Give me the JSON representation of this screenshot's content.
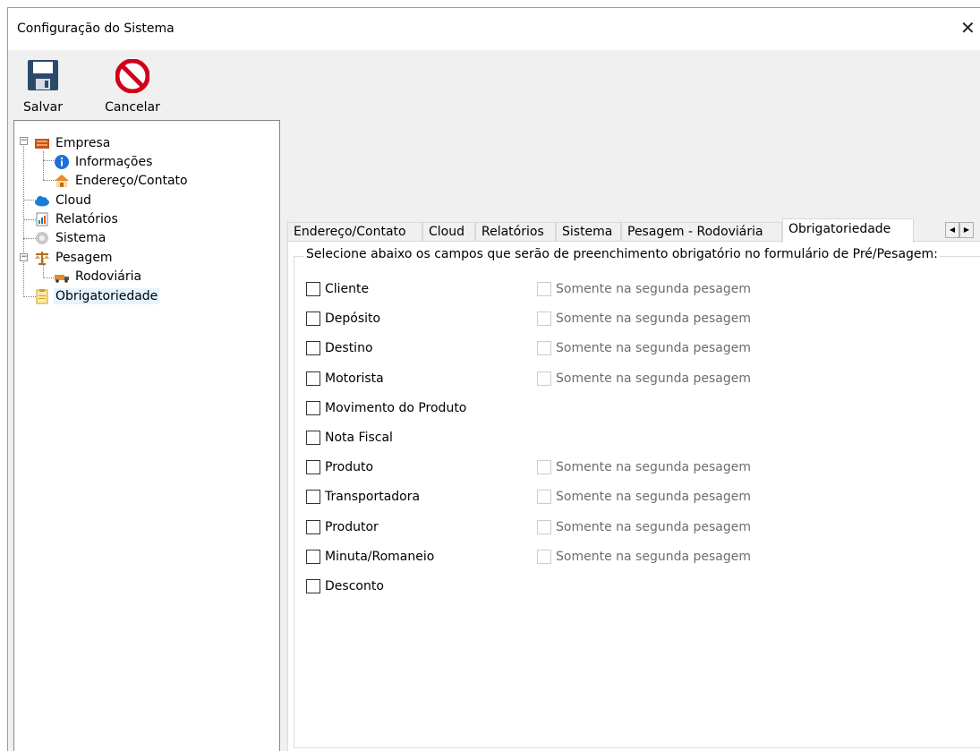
{
  "window": {
    "title": "Configuração do Sistema",
    "close_glyph": "✕"
  },
  "toolbar": {
    "save_label": "Salvar",
    "cancel_label": "Cancelar"
  },
  "tree": {
    "empresa": "Empresa",
    "informacoes": "Informações",
    "endereco": "Endereço/Contato",
    "cloud": "Cloud",
    "relatorios": "Relatórios",
    "sistema": "Sistema",
    "pesagem": "Pesagem",
    "rodoviaria": "Rodoviária",
    "obrigatoriedade": "Obrigatoriedade",
    "selected": "Obrigatoriedade"
  },
  "tabs": [
    {
      "label": "Endereço/Contato"
    },
    {
      "label": "Cloud"
    },
    {
      "label": "Relatórios"
    },
    {
      "label": "Sistema"
    },
    {
      "label": "Pesagem - Rodoviária"
    },
    {
      "label": "Obrigatoriedade"
    }
  ],
  "active_tab": "Obrigatoriedade",
  "panel": {
    "legend": "Selecione abaixo os campos que serão de preenchimento obrigatório no formulário de Pré/Pesagem:",
    "second_label": "Somente na segunda pesagem",
    "fields": [
      {
        "label": "Cliente",
        "checked": false,
        "has_second": true
      },
      {
        "label": "Depósito",
        "checked": false,
        "has_second": true
      },
      {
        "label": "Destino",
        "checked": false,
        "has_second": true
      },
      {
        "label": "Motorista",
        "checked": false,
        "has_second": true
      },
      {
        "label": "Movimento do Produto",
        "checked": false,
        "has_second": false
      },
      {
        "label": "Nota Fiscal",
        "checked": false,
        "has_second": false
      },
      {
        "label": "Produto",
        "checked": false,
        "has_second": true
      },
      {
        "label": "Transportadora",
        "checked": false,
        "has_second": true
      },
      {
        "label": "Produtor",
        "checked": false,
        "has_second": true
      },
      {
        "label": "Minuta/Romaneio",
        "checked": false,
        "has_second": true
      },
      {
        "label": "Desconto",
        "checked": false,
        "has_second": false
      }
    ]
  },
  "icons": {
    "save": "floppy-disk-icon",
    "cancel": "cancel-icon",
    "empresa": "building-icon",
    "informacoes": "info-icon",
    "endereco": "house-icon",
    "cloud": "cloud-icon",
    "relatorios": "report-icon",
    "sistema": "gear-icon",
    "pesagem": "scale-icon",
    "rodoviaria": "truck-icon",
    "obrigatoriedade": "clipboard-icon"
  },
  "colors": {
    "accent": "#e5f3ff",
    "cancel_red": "#d0021b",
    "info_blue": "#1e6fd9",
    "cloud_blue": "#1a7bd6"
  }
}
